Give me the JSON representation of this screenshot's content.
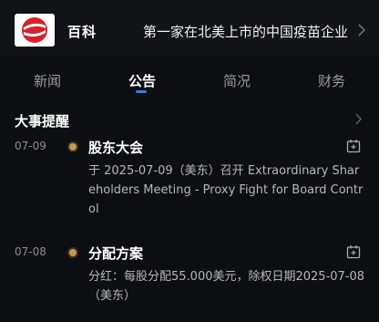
{
  "header": {
    "company_label": "百科",
    "description": "第一家在北美上市的中国疫苗企业",
    "logo_icon": "sinovac-logo",
    "chevron_icon": "chevron-right-icon"
  },
  "tabs": [
    {
      "label": "新闻",
      "active": false
    },
    {
      "label": "公告",
      "active": true
    },
    {
      "label": "简况",
      "active": false
    },
    {
      "label": "财务",
      "active": false
    }
  ],
  "section": {
    "title": "大事提醒",
    "chevron_icon": "chevron-right-icon"
  },
  "events": [
    {
      "date": "07-09",
      "title": "股东大会",
      "body": "于 2025-07-09（美东）召开 Extraordinary Shareholders Meeting - Proxy Fight for Board Control",
      "icon": "add-to-calendar-icon"
    },
    {
      "date": "07-08",
      "title": "分配方案",
      "body": "分红：每股分配55.000美元，除权日期2025-07-08（美东）",
      "icon": "add-to-calendar-icon"
    }
  ],
  "colors": {
    "background": "#0d0e12",
    "accent": "#2f7cf6",
    "dot": "#c99a52",
    "logo_red": "#d7202b"
  }
}
